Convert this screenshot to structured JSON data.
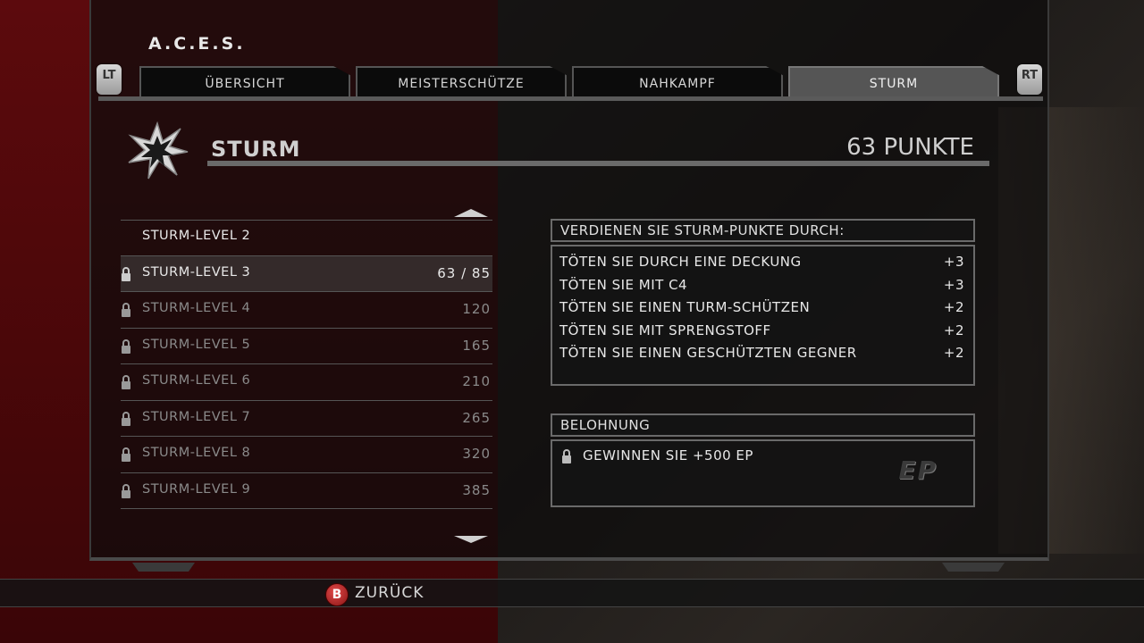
{
  "header": {
    "title": "A.C.E.S."
  },
  "bumpers": {
    "left": "LT",
    "right": "RT"
  },
  "tabs": [
    {
      "label": "ÜBERSICHT",
      "active": false
    },
    {
      "label": "MEISTERSCHÜTZE",
      "active": false
    },
    {
      "label": "NAHKAMPF",
      "active": false
    },
    {
      "label": "STURM",
      "active": true
    }
  ],
  "category": {
    "name": "STURM",
    "points": "63 PUNKTE",
    "icon": "starburst-icon"
  },
  "levels": [
    {
      "label": "STURM-LEVEL 2",
      "value": "",
      "state": "done"
    },
    {
      "label": "STURM-LEVEL 3",
      "value": "63 / 85",
      "state": "current"
    },
    {
      "label": "STURM-LEVEL 4",
      "value": "120",
      "state": "locked"
    },
    {
      "label": "STURM-LEVEL 5",
      "value": "165",
      "state": "locked"
    },
    {
      "label": "STURM-LEVEL 6",
      "value": "210",
      "state": "locked"
    },
    {
      "label": "STURM-LEVEL 7",
      "value": "265",
      "state": "locked"
    },
    {
      "label": "STURM-LEVEL 8",
      "value": "320",
      "state": "locked"
    },
    {
      "label": "STURM-LEVEL 9",
      "value": "385",
      "state": "locked"
    }
  ],
  "earn": {
    "header": "VERDIENEN SIE STURM-PUNKTE DURCH:",
    "items": [
      {
        "label": "TÖTEN SIE DURCH EINE DECKUNG",
        "points": "+3"
      },
      {
        "label": "TÖTEN SIE MIT C4",
        "points": "+3"
      },
      {
        "label": "TÖTEN SIE EINEN TURM-SCHÜTZEN",
        "points": "+2"
      },
      {
        "label": "TÖTEN SIE MIT SPRENGSTOFF",
        "points": "+2"
      },
      {
        "label": "TÖTEN SIE EINEN GESCHÜTZTEN GEGNER",
        "points": "+2"
      }
    ]
  },
  "reward": {
    "header": "BELOHNUNG",
    "text": "GEWINNEN SIE +500 EP",
    "badge": "EP"
  },
  "footer": {
    "button": "B",
    "label": "ZURÜCK"
  },
  "colors": {
    "accent_red": "#5c0a0d",
    "button_b": "#c02a2a"
  }
}
